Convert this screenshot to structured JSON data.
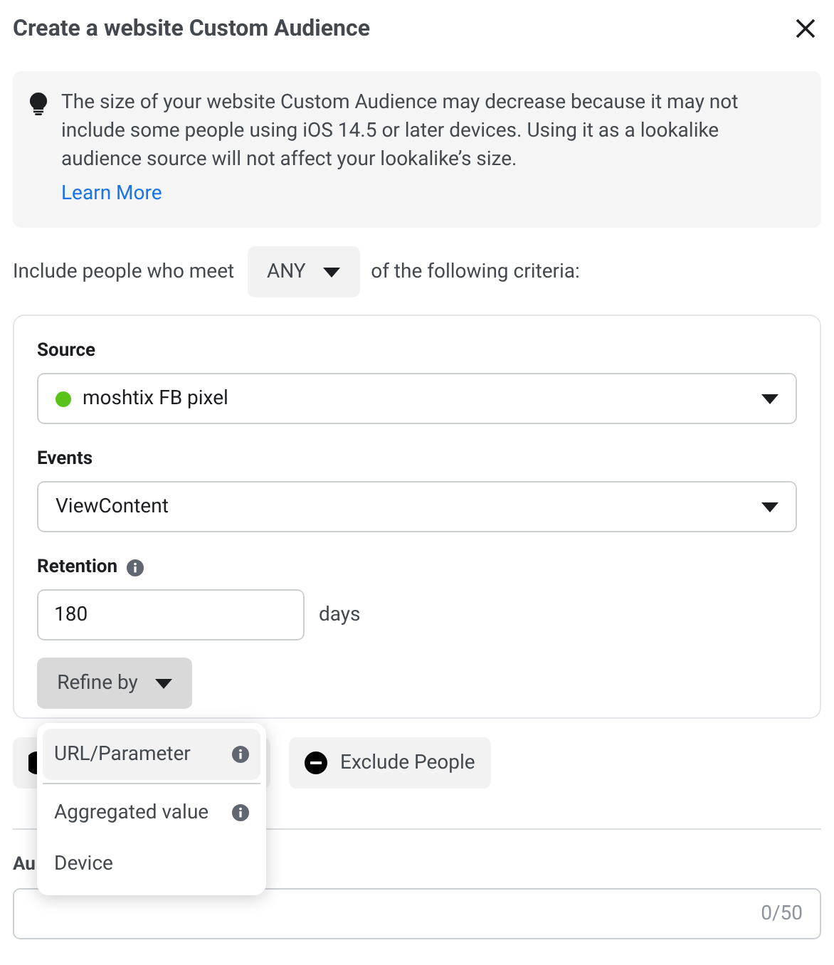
{
  "dialog": {
    "title": "Create a website Custom Audience"
  },
  "notice": {
    "text": "The size of your website Custom Audience may decrease because it may not include some people using iOS 14.5 or later devices. Using it as a lookalike audience source will not affect your lookalike’s size.",
    "link": "Learn More"
  },
  "criteria": {
    "prefix": "Include people who meet",
    "match": "ANY",
    "suffix": "of the following criteria:"
  },
  "rule": {
    "source": {
      "label": "Source",
      "value": "moshtix FB pixel",
      "color": "#5ac31a"
    },
    "events": {
      "label": "Events",
      "value": "ViewContent"
    },
    "retention": {
      "label": "Retention",
      "value": "180",
      "unit": "days"
    },
    "refine": {
      "label": "Refine by",
      "expanded": true,
      "menu": [
        {
          "label": "URL/Parameter",
          "info": true,
          "selected": true
        },
        {
          "label": "Aggregated value",
          "info": true,
          "selected": false
        },
        {
          "label": "Device",
          "info": false,
          "selected": false
        }
      ]
    }
  },
  "exclude_button": "Exclude People",
  "audience_name": {
    "label": "Au",
    "counter": "0/50"
  }
}
